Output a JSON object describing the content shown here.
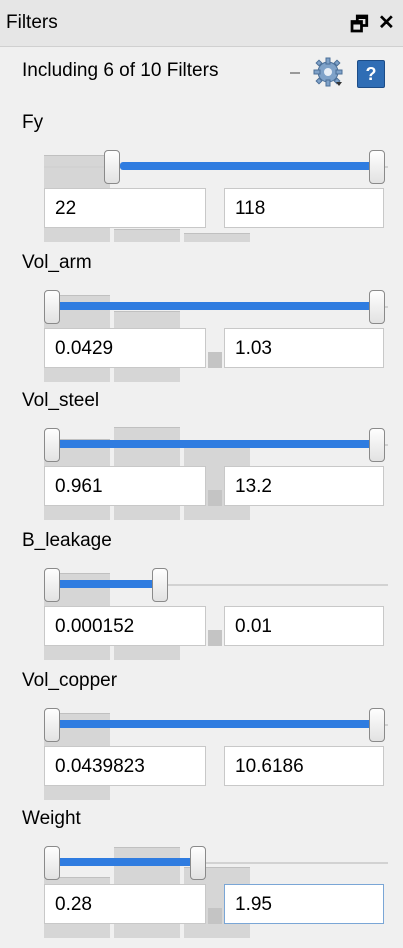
{
  "window": {
    "title": "Filters",
    "restore_label": "🗗",
    "close_label": "✕"
  },
  "summary": {
    "text": "Including 6 of 10 Filters"
  },
  "filters": [
    {
      "name": "Fy",
      "min": "22",
      "max": "118",
      "low_frac": 0.22,
      "high_frac": 1.0
    },
    {
      "name": "Vol_arm",
      "min": "0.0429",
      "max": "1.03",
      "low_frac": 0.0,
      "high_frac": 1.0
    },
    {
      "name": "Vol_steel",
      "min": "0.961",
      "max": "13.2",
      "low_frac": 0.0,
      "high_frac": 1.0
    },
    {
      "name": "B_leakage",
      "min": "0.000152",
      "max": "0.01",
      "low_frac": 0.0,
      "high_frac": 0.35
    },
    {
      "name": "Vol_copper",
      "min": "0.0439823",
      "max": "10.6186",
      "low_frac": 0.0,
      "high_frac": 1.0
    },
    {
      "name": "Weight",
      "min": "0.28",
      "max": "1.95",
      "low_frac": 0.0,
      "high_frac": 0.45
    }
  ]
}
